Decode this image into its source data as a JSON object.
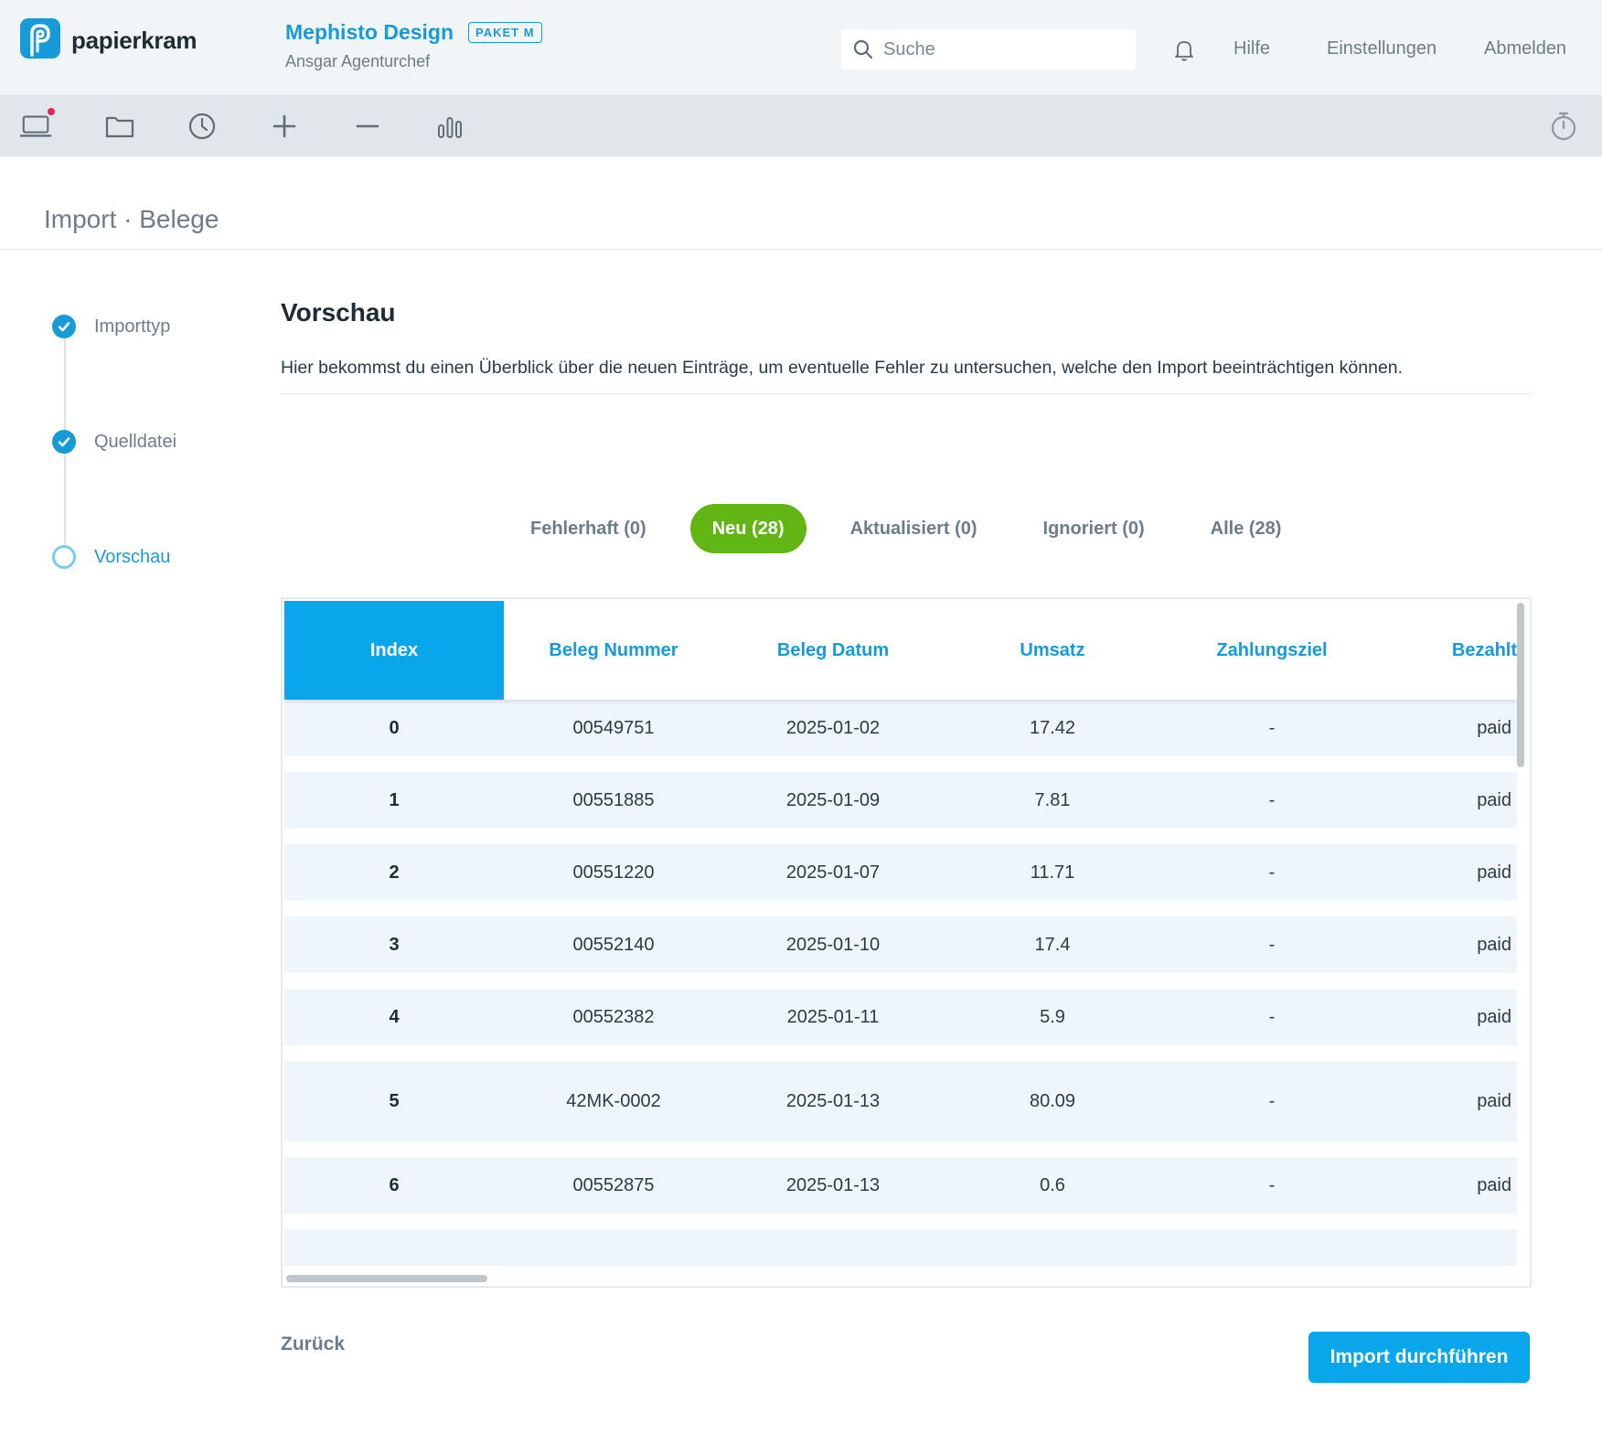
{
  "brand": {
    "name": "papierkram",
    "accent": "#169bd8"
  },
  "company": {
    "name": "Mephisto Design",
    "plan_badge": "PAKET M",
    "user": "Ansgar Agenturchef"
  },
  "search": {
    "placeholder": "Suche"
  },
  "header_nav": {
    "help": "Hilfe",
    "settings": "Einstellungen",
    "logout": "Abmelden"
  },
  "toolbar": [
    "laptop-icon",
    "folder-icon",
    "clock-icon",
    "plus-icon",
    "minus-icon",
    "bar-chart-icon",
    "stopwatch-icon"
  ],
  "breadcrumb": "Import · Belege",
  "steps": [
    {
      "label": "Importtyp",
      "state": "done"
    },
    {
      "label": "Quelldatei",
      "state": "done"
    },
    {
      "label": "Vorschau",
      "state": "current"
    }
  ],
  "preview": {
    "title": "Vorschau",
    "description": "Hier bekommst du einen Überblick über die neuen Einträge, um eventuelle Fehler zu untersuchen, welche den Import beeinträchtigen können."
  },
  "filters": [
    {
      "label": "Fehlerhaft (0)",
      "active": false
    },
    {
      "label": "Neu (28)",
      "active": true
    },
    {
      "label": "Aktualisiert (0)",
      "active": false
    },
    {
      "label": "Ignoriert (0)",
      "active": false
    },
    {
      "label": "Alle (28)",
      "active": false
    }
  ],
  "table": {
    "columns": [
      "Index",
      "Beleg Nummer",
      "Beleg Datum",
      "Umsatz",
      "Zahlungsziel",
      "Bezahlt"
    ],
    "rows": [
      [
        "0",
        "00549751",
        "2025-01-02",
        "17.42",
        "-",
        "paid"
      ],
      [
        "1",
        "00551885",
        "2025-01-09",
        "7.81",
        "-",
        "paid"
      ],
      [
        "2",
        "00551220",
        "2025-01-07",
        "11.71",
        "-",
        "paid"
      ],
      [
        "3",
        "00552140",
        "2025-01-10",
        "17.4",
        "-",
        "paid"
      ],
      [
        "4",
        "00552382",
        "2025-01-11",
        "5.9",
        "-",
        "paid"
      ],
      [
        "5",
        "42MK-0002",
        "2025-01-13",
        "80.09",
        "-",
        "paid"
      ],
      [
        "6",
        "00552875",
        "2025-01-13",
        "0.6",
        "-",
        "paid"
      ]
    ]
  },
  "footer": {
    "back": "Zurück",
    "submit": "Import durchführen"
  },
  "colors": {
    "primary": "#0aa6ec",
    "active_filter": "#61b614",
    "row_bg": "#eff6fb",
    "notification": "#e6245c"
  }
}
